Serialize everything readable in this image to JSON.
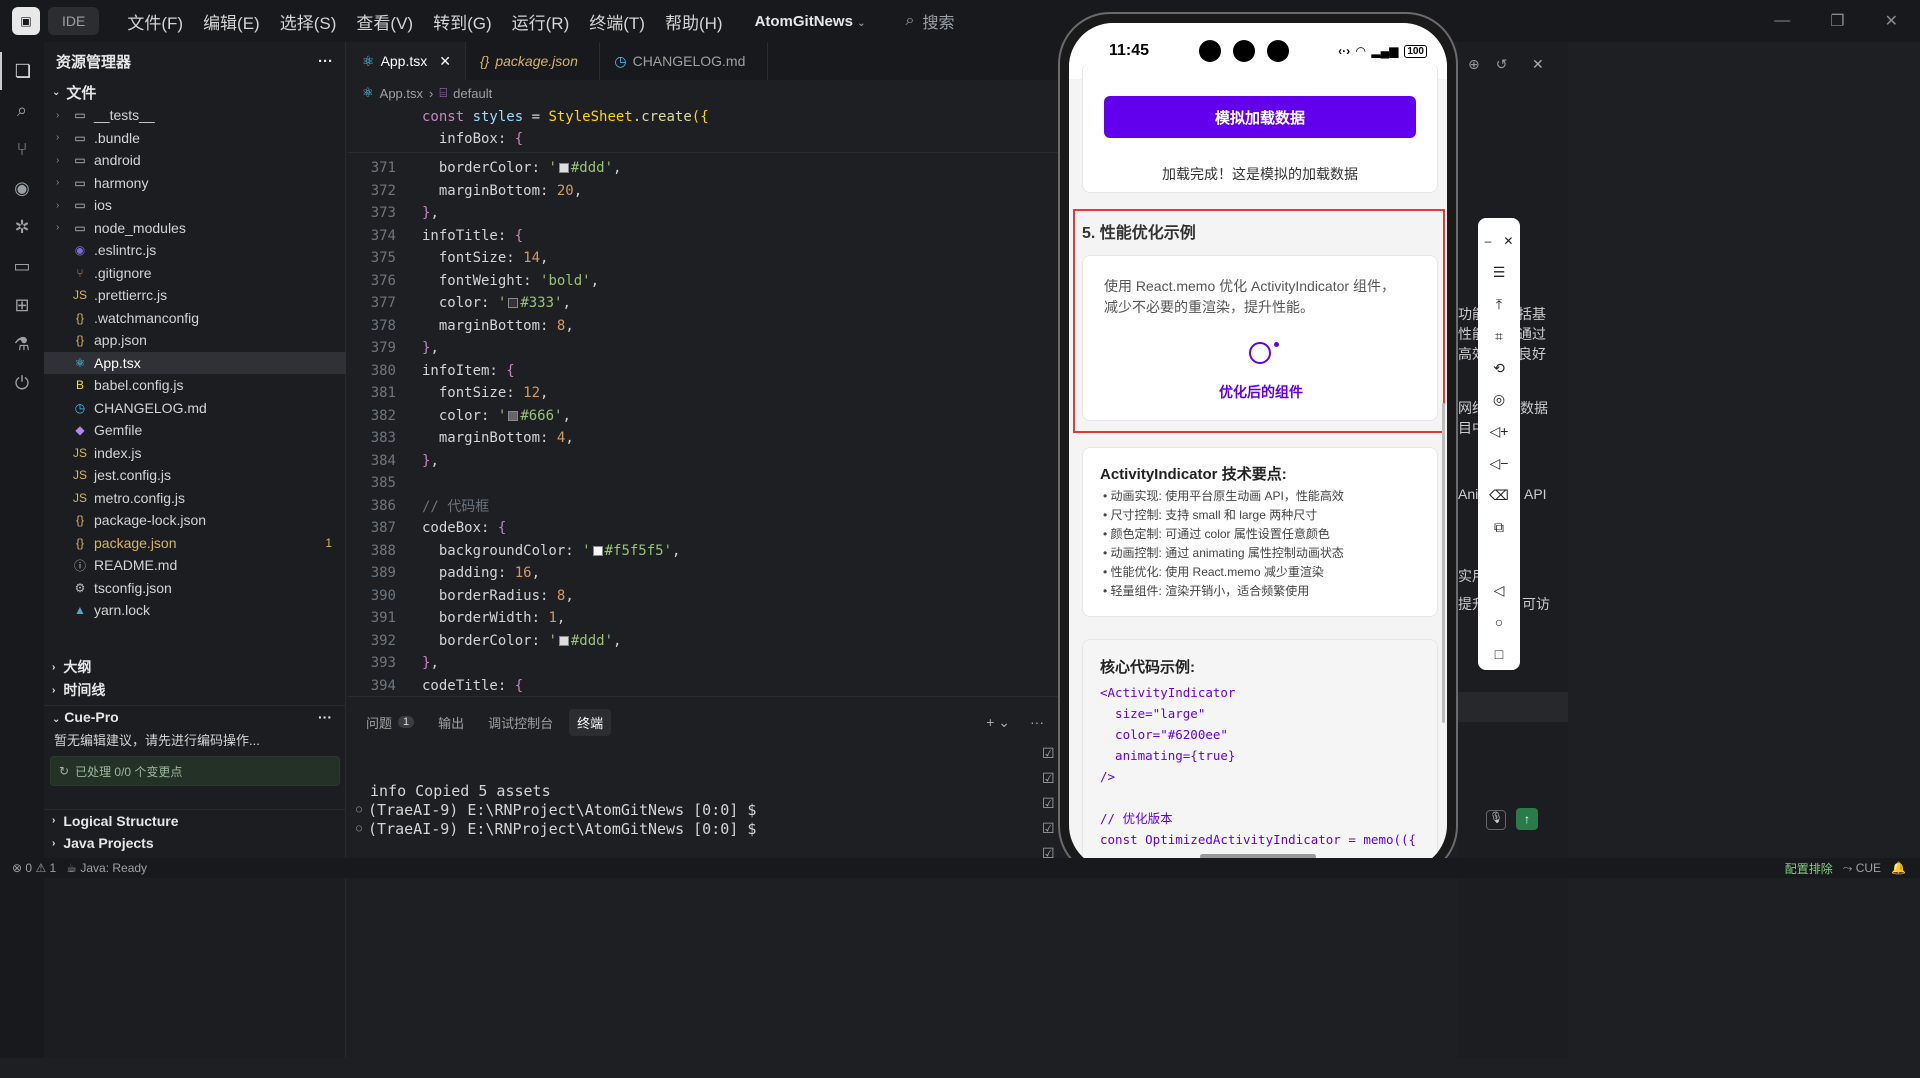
{
  "topbar": {
    "ide_label": "IDE",
    "menus": [
      "文件(F)",
      "编辑(E)",
      "选择(S)",
      "查看(V)",
      "转到(G)",
      "运行(R)",
      "终端(T)",
      "帮助(H)"
    ],
    "project": "AtomGitNews",
    "search": "搜索"
  },
  "sidebar": {
    "title": "资源管理器",
    "root": "文件",
    "items": [
      {
        "label": "__tests__",
        "icon": "folder-icon"
      },
      {
        "label": ".bundle",
        "icon": "folder-icon"
      },
      {
        "label": "android",
        "icon": "folder-icon"
      },
      {
        "label": "harmony",
        "icon": "folder-icon"
      },
      {
        "label": "ios",
        "icon": "folder-icon"
      },
      {
        "label": "node_modules",
        "icon": "folder-icon"
      },
      {
        "label": ".eslintrc.js",
        "icon": "eslint-icon"
      },
      {
        "label": ".gitignore",
        "icon": "git-icon"
      },
      {
        "label": ".prettierrc.js",
        "icon": "js-icon"
      },
      {
        "label": ".watchmanconfig",
        "icon": "json-icon"
      },
      {
        "label": "app.json",
        "icon": "json-icon"
      },
      {
        "label": "App.tsx",
        "icon": "react-icon"
      },
      {
        "label": "babel.config.js",
        "icon": "babel-icon"
      },
      {
        "label": "CHANGELOG.md",
        "icon": "clock-icon"
      },
      {
        "label": "Gemfile",
        "icon": "gem-icon"
      },
      {
        "label": "index.js",
        "icon": "js-icon"
      },
      {
        "label": "jest.config.js",
        "icon": "js-icon"
      },
      {
        "label": "metro.config.js",
        "icon": "js-icon"
      },
      {
        "label": "package-lock.json",
        "icon": "json-icon"
      },
      {
        "label": "package.json",
        "icon": "json-icon",
        "badge": "1"
      },
      {
        "label": "README.md",
        "icon": "info-icon"
      },
      {
        "label": "tsconfig.json",
        "icon": "gear-icon"
      },
      {
        "label": "yarn.lock",
        "icon": "yarn-icon"
      }
    ],
    "outline": "大纲",
    "timeline": "时间线",
    "cue_title": "Cue-Pro",
    "cue_msg": "暂无编辑建议，请先进行编码操作...",
    "cue_status": "已处理 0/0 个变更点",
    "logical": "Logical Structure",
    "java": "Java Projects"
  },
  "editor": {
    "tabs": [
      {
        "label": "App.tsx"
      },
      {
        "label": "package.json"
      },
      {
        "label": "CHANGELOG.md"
      }
    ],
    "breadcrumb": [
      "App.tsx",
      "default"
    ],
    "sticky": [
      "const styles = StyleSheet.create({",
      "infoBox: {"
    ],
    "lines": [
      {
        "n": "371",
        "t": "borderColor: '#ddd',"
      },
      {
        "n": "372",
        "t": "marginBottom: 20,"
      },
      {
        "n": "373",
        "t": "},"
      },
      {
        "n": "374",
        "t": "infoTitle: {"
      },
      {
        "n": "375",
        "t": "fontSize: 14,"
      },
      {
        "n": "376",
        "t": "fontWeight: 'bold',"
      },
      {
        "n": "377",
        "t": "color: '#333',"
      },
      {
        "n": "378",
        "t": "marginBottom: 8,"
      },
      {
        "n": "379",
        "t": "},"
      },
      {
        "n": "380",
        "t": "infoItem: {"
      },
      {
        "n": "381",
        "t": "fontSize: 12,"
      },
      {
        "n": "382",
        "t": "color: '#666',"
      },
      {
        "n": "383",
        "t": "marginBottom: 4,"
      },
      {
        "n": "384",
        "t": "},"
      },
      {
        "n": "385",
        "t": ""
      },
      {
        "n": "386",
        "t": "// 代码框"
      },
      {
        "n": "387",
        "t": "codeBox: {"
      },
      {
        "n": "388",
        "t": "backgroundColor: '#f5f5f5',"
      },
      {
        "n": "389",
        "t": "padding: 16,"
      },
      {
        "n": "390",
        "t": "borderRadius: 8,"
      },
      {
        "n": "391",
        "t": "borderWidth: 1,"
      },
      {
        "n": "392",
        "t": "borderColor: '#ddd',"
      },
      {
        "n": "393",
        "t": "},"
      },
      {
        "n": "394",
        "t": "codeTitle: {"
      }
    ]
  },
  "panel": {
    "tabs": [
      "问题",
      "输出",
      "调试控制台",
      "终端"
    ],
    "problem_count": "1",
    "term_lines": [
      "info Copied 5 assets",
      "(TraeAI-9) E:\\RNProject\\AtomGitNews [0:0] $",
      "(TraeAI-9) E:\\RNProject\\AtomGitNews [0:0] $"
    ]
  },
  "phone": {
    "time": "11:45",
    "battery": "100",
    "load_button": "模拟加载数据",
    "load_done": "加载完成！这是模拟的加载数据",
    "section5": "5. 性能优化示例",
    "memo_desc1": "使用 React.memo 优化 ActivityIndicator 组件，",
    "memo_desc2": "减少不必要的重渲染，提升性能。",
    "optimized": "优化后的组件",
    "tech_title": "ActivityIndicator 技术要点:",
    "tech_items": [
      "动画实现: 使用平台原生动画 API，性能高效",
      "尺寸控制: 支持 small 和 large 两种尺寸",
      "颜色定制: 可通过 color 属性设置任意颜色",
      "动画控制: 通过 animating 属性控制动画状态",
      "性能优化: 使用 React.memo 减少重渲染",
      "轻量组件: 渲染开销小，适合频繁使用"
    ],
    "code_title": "核心代码示例:",
    "code_lines": [
      "<ActivityIndicator",
      "  size=\"large\"",
      "  color=\"#6200ee\"",
      "  animating={true}",
      "/>",
      "",
      "// 优化版本",
      "const OptimizedActivityIndicator = memo(({"
    ]
  },
  "right_snippets": [
    "功能",
    "括基",
    "性能",
    "通过",
    "高效",
    "良好",
    "网络",
    "数据",
    "目中",
    "Ani",
    "API",
    "实用",
    "提升",
    "可访"
  ],
  "footer": {
    "errors": "0",
    "warnings": "1",
    "java": "Java: Ready",
    "right1": "配置排除",
    "right2": "CUE"
  }
}
